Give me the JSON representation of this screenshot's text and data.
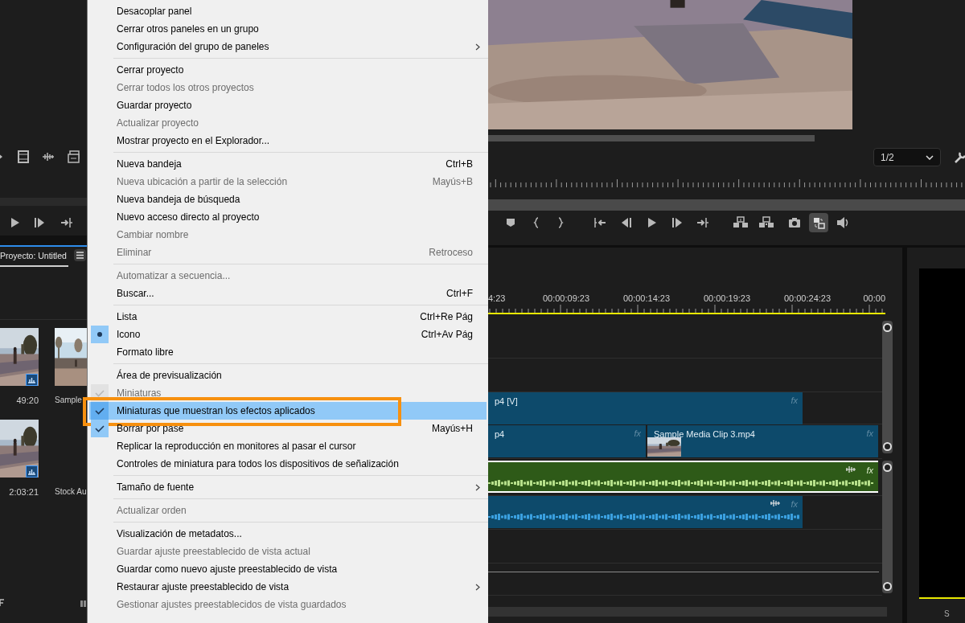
{
  "menu": {
    "groups": [
      {
        "items": [
          {
            "label": "Desacoplar panel",
            "disabled": false,
            "checked": false,
            "submenu": false,
            "selected": false,
            "annotated": false
          },
          {
            "label": "Cerrar otros paneles en un grupo",
            "disabled": false,
            "checked": false,
            "submenu": false,
            "selected": false,
            "annotated": false
          },
          {
            "label": "Configuración del grupo de paneles",
            "disabled": false,
            "checked": false,
            "submenu": true,
            "selected": false,
            "annotated": false
          }
        ]
      },
      {
        "items": [
          {
            "label": "Cerrar proyecto",
            "disabled": false,
            "checked": false,
            "submenu": false,
            "selected": false,
            "annotated": false
          },
          {
            "label": "Cerrar todos los otros proyectos",
            "disabled": true,
            "checked": false,
            "submenu": false,
            "selected": false,
            "annotated": false
          },
          {
            "label": "Guardar proyecto",
            "disabled": false,
            "checked": false,
            "submenu": false,
            "selected": false,
            "annotated": false
          },
          {
            "label": "Actualizar proyecto",
            "disabled": true,
            "checked": false,
            "submenu": false,
            "selected": false,
            "annotated": false
          },
          {
            "label": "Mostrar proyecto en el Explorador...",
            "disabled": false,
            "checked": false,
            "submenu": false,
            "selected": false,
            "annotated": false
          }
        ]
      },
      {
        "items": [
          {
            "label": "Nueva bandeja",
            "shortcut": "Ctrl+B",
            "disabled": false,
            "checked": false,
            "submenu": false,
            "selected": false,
            "annotated": false
          },
          {
            "label": "Nueva ubicación a partir de la selección",
            "shortcut": "Mayús+B",
            "disabled": true,
            "checked": false,
            "submenu": false,
            "selected": false,
            "annotated": false
          },
          {
            "label": "Nueva bandeja de búsqueda",
            "disabled": false,
            "checked": false,
            "submenu": false,
            "selected": false,
            "annotated": false
          },
          {
            "label": "Nuevo acceso directo al proyecto",
            "disabled": false,
            "checked": false,
            "submenu": false,
            "selected": false,
            "annotated": false
          },
          {
            "label": "Cambiar nombre",
            "disabled": true,
            "checked": false,
            "submenu": false,
            "selected": false,
            "annotated": false
          },
          {
            "label": "Eliminar",
            "shortcut": "Retroceso",
            "disabled": true,
            "checked": false,
            "submenu": false,
            "selected": false,
            "annotated": false
          }
        ]
      },
      {
        "items": [
          {
            "label": "Automatizar a secuencia...",
            "disabled": true,
            "checked": false,
            "submenu": false,
            "selected": false,
            "annotated": false
          },
          {
            "label": "Buscar...",
            "shortcut": "Ctrl+F",
            "disabled": false,
            "checked": false,
            "submenu": false,
            "selected": false,
            "annotated": false
          }
        ]
      },
      {
        "kind": "radio",
        "items": [
          {
            "label": "Lista",
            "shortcut": "Ctrl+Re Pág",
            "disabled": false,
            "checked": false,
            "submenu": false,
            "selected": false,
            "annotated": false
          },
          {
            "label": "Icono",
            "shortcut": "Ctrl+Av Pág",
            "disabled": false,
            "checked": true,
            "submenu": false,
            "selected": false,
            "annotated": false
          },
          {
            "label": "Formato libre",
            "disabled": false,
            "checked": false,
            "submenu": false,
            "selected": false,
            "annotated": false
          }
        ]
      },
      {
        "items": [
          {
            "label": "Área de previsualización",
            "disabled": false,
            "checked": false,
            "submenu": false,
            "selected": false,
            "annotated": false
          },
          {
            "label": "Miniaturas",
            "disabled": true,
            "checked": true,
            "submenu": false,
            "selected": false,
            "annotated": false
          },
          {
            "label": "Miniaturas que muestran los efectos aplicados",
            "disabled": false,
            "checked": true,
            "submenu": false,
            "selected": true,
            "annotated": true
          },
          {
            "label": "Borrar por pase",
            "shortcut": "Mayús+H",
            "disabled": false,
            "checked": true,
            "submenu": false,
            "selected": false,
            "annotated": false
          },
          {
            "label": "Replicar la reproducción en monitores al pasar el cursor",
            "disabled": false,
            "checked": false,
            "submenu": false,
            "selected": false,
            "annotated": false
          },
          {
            "label": "Controles de miniatura para todos los dispositivos de señalización",
            "disabled": false,
            "checked": false,
            "submenu": false,
            "selected": false,
            "annotated": false
          }
        ]
      },
      {
        "items": [
          {
            "label": "Tamaño de fuente",
            "disabled": false,
            "checked": false,
            "submenu": true,
            "selected": false,
            "annotated": false
          }
        ]
      },
      {
        "items": [
          {
            "label": "Actualizar orden",
            "disabled": true,
            "checked": false,
            "submenu": false,
            "selected": false,
            "annotated": false
          }
        ]
      },
      {
        "items": [
          {
            "label": "Visualización de metadatos...",
            "disabled": false,
            "checked": false,
            "submenu": false,
            "selected": false,
            "annotated": false
          },
          {
            "label": "Guardar ajuste preestablecido de vista actual",
            "disabled": true,
            "checked": false,
            "submenu": false,
            "selected": false,
            "annotated": false
          },
          {
            "label": "Guardar como nuevo ajuste preestablecido de vista",
            "disabled": false,
            "checked": false,
            "submenu": false,
            "selected": false,
            "annotated": false
          },
          {
            "label": "Restaurar ajuste preestablecido de vista",
            "disabled": false,
            "checked": false,
            "submenu": true,
            "selected": false,
            "annotated": false
          },
          {
            "label": "Gestionar ajustes preestablecidos de vista guardados",
            "disabled": true,
            "checked": false,
            "submenu": false,
            "selected": false,
            "annotated": false
          }
        ]
      }
    ]
  },
  "project_panel": {
    "tab_title": "Proyecto: Untitled",
    "items": [
      {
        "duration": "49:20",
        "thumbnail": true
      },
      {
        "name": "Sample",
        "thumbnail": true
      },
      {
        "duration": "2:03:21",
        "thumbnail": true
      },
      {
        "name": "Stock Au",
        "thumbnail": false
      }
    ]
  },
  "program_monitor": {
    "resolution": "1/2"
  },
  "timeline": {
    "time_labels": [
      "4:23",
      "00:00:09:23",
      "00:00:14:23",
      "00:00:19:23",
      "00:00:24:23",
      "00:00"
    ],
    "clips": [
      {
        "kind": "video",
        "label": "p4 [V]",
        "badge": "fx",
        "selected": false,
        "thumbnail": false,
        "color": "#0d4a6b"
      },
      {
        "kind": "video",
        "label": "p4",
        "badge": "fx",
        "selected": false,
        "thumbnail": false,
        "color": "#0d4a6b"
      },
      {
        "kind": "video",
        "label": "Sample Media Clip 3.mp4",
        "badge": "fx",
        "selected": false,
        "thumbnail": true,
        "color": "#0d4a6b"
      },
      {
        "kind": "audio",
        "badge": "fx",
        "selected": true,
        "thumbnail": false,
        "color": "#2e5a18"
      },
      {
        "kind": "audio",
        "badge": "fx",
        "selected": false,
        "thumbnail": false,
        "color": "#0d4a6b"
      }
    ]
  },
  "meter_panel": {
    "label": "S"
  }
}
